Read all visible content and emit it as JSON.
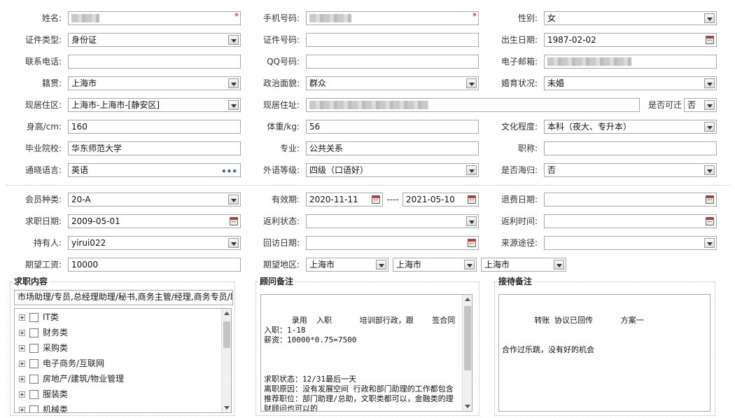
{
  "personal": {
    "name": {
      "label": "姓名:",
      "value": ""
    },
    "mobile": {
      "label": "手机号码:",
      "value": ""
    },
    "gender": {
      "label": "性别:",
      "value": "女"
    },
    "id_type": {
      "label": "证件类型:",
      "value": "身份证"
    },
    "id_number": {
      "label": "证件号码:",
      "value": ""
    },
    "birth_date": {
      "label": "出生日期:",
      "value": "1987-02-02"
    },
    "phone": {
      "label": "联系电话:",
      "value": ""
    },
    "qq": {
      "label": "QQ号码:",
      "value": ""
    },
    "email": {
      "label": "电子邮箱:",
      "value": ""
    },
    "native_place": {
      "label": "籍贯:",
      "value": "上海市"
    },
    "political": {
      "label": "政治面貌:",
      "value": "群众"
    },
    "marital": {
      "label": "婚育状况:",
      "value": "未婚"
    },
    "residence_area": {
      "label": "现居住区:",
      "value": "上海市-上海市-[静安区]"
    },
    "residence_addr": {
      "label": "现居住址:",
      "value": ""
    },
    "relocate": {
      "label": "是否可迁",
      "value": "否"
    },
    "height": {
      "label": "身高/cm:",
      "value": "160"
    },
    "weight": {
      "label": "体重/kg:",
      "value": "56"
    },
    "education": {
      "label": "文化程度:",
      "value": "本科（夜大、专升本）"
    },
    "school": {
      "label": "毕业院校:",
      "value": "华东师范大学"
    },
    "major": {
      "label": "专业:",
      "value": "公共关系"
    },
    "title": {
      "label": "职称:",
      "value": ""
    },
    "language": {
      "label": "通晓语言:",
      "value": "英语"
    },
    "language_level": {
      "label": "外语等级:",
      "value": "四级（口语好）"
    },
    "overseas": {
      "label": "是否海归:",
      "value": "否"
    }
  },
  "membership": {
    "member_type": {
      "label": "会员种类:",
      "value": "20-A"
    },
    "validity": {
      "label": "有效期:",
      "from": "2020-11-11",
      "sep": "----",
      "to": "2021-05-10"
    },
    "refund_date": {
      "label": "退费日期:",
      "value": ""
    },
    "job_date": {
      "label": "求职日期:",
      "value": "2009-05-01"
    },
    "rebate_status": {
      "label": "返利状态:",
      "value": ""
    },
    "rebate_time": {
      "label": "返利时间:",
      "value": ""
    },
    "holder": {
      "label": "持有人:",
      "value": "yirui022"
    },
    "revisit_date": {
      "label": "回访日期:",
      "value": ""
    },
    "source": {
      "label": "来源途径:",
      "value": ""
    },
    "salary": {
      "label": "期望工资:",
      "value": "10000"
    },
    "region": {
      "label": "期望地区:",
      "values": [
        "上海市",
        "上海市",
        "上海市"
      ]
    }
  },
  "job_content": {
    "legend": "求职内容",
    "summary": "市场助理/专员,总经理助理/秘书,商务主管/经理,商务专员/助",
    "categories": [
      "IT类",
      "财务类",
      "采购类",
      "电子商务/互联网",
      "房地产/建筑/物业管理",
      "服装类",
      "机械类"
    ]
  },
  "consultant_notes": {
    "legend": "顾问备注",
    "text": "      录用  入职      培训部行政，跟    签合同\n入职：1-18\n薪资：10000*0.75=7500\n\n\n\n求职状态：12/31最后一天\n离职原因：没有发展空间 行政和部门助理的工作都包含\n推荐职位：部门助理/总助，文职类都可以，金融类的理财顾问也可以的"
  },
  "reception_notes": {
    "legend": "接待备注",
    "text": "       转账 协议已回传      方案一\n\n\n合作过乐跳，没有好的机会"
  }
}
